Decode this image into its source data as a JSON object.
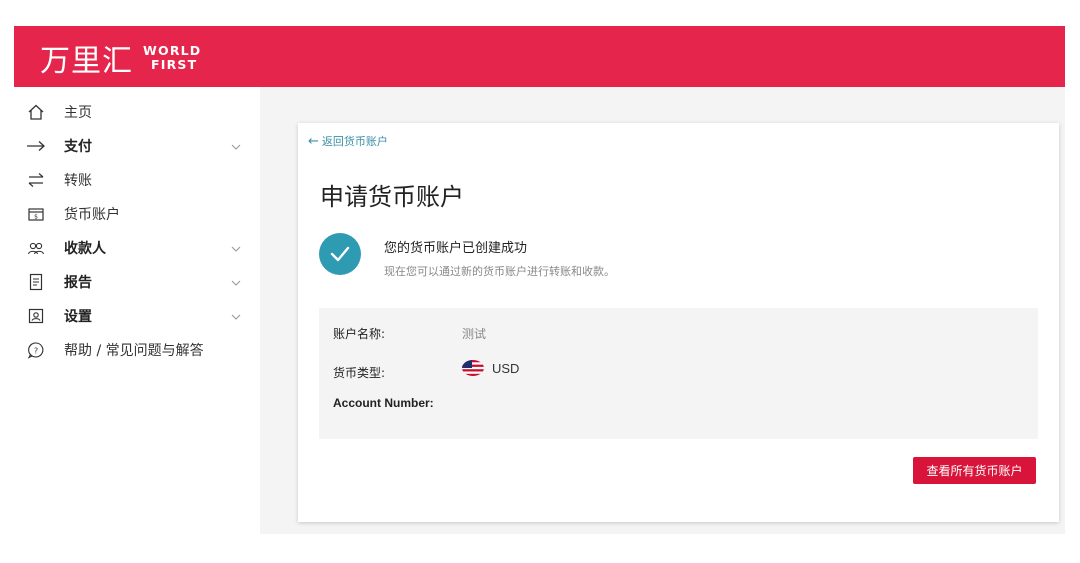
{
  "brand": {
    "logo_cn": "万里汇",
    "logo_en_line1": "WORLD",
    "logo_en_line2": "FIRST",
    "primary_color": "#e5254b",
    "accent_color": "#2f9bb2"
  },
  "sidebar": {
    "items": [
      {
        "label": "主页",
        "icon": "home-icon",
        "has_chevron": false
      },
      {
        "label": "支付",
        "icon": "arrow-right-icon",
        "has_chevron": true
      },
      {
        "label": "转账",
        "icon": "transfer-icon",
        "has_chevron": false
      },
      {
        "label": "货币账户",
        "icon": "wallet-icon",
        "has_chevron": false
      },
      {
        "label": "收款人",
        "icon": "users-icon",
        "has_chevron": true
      },
      {
        "label": "报告",
        "icon": "report-icon",
        "has_chevron": true
      },
      {
        "label": "设置",
        "icon": "settings-icon",
        "has_chevron": true
      },
      {
        "label": "帮助 / 常见问题与解答",
        "icon": "help-icon",
        "has_chevron": false
      }
    ]
  },
  "main": {
    "back_link": "返回货币账户",
    "title": "申请货币账户",
    "success_title": "您的货币账户已创建成功",
    "success_sub": "现在您可以通过新的货币账户进行转账和收款。",
    "details": {
      "account_name_label": "账户名称:",
      "account_name_value": "测试",
      "currency_label": "货币类型:",
      "currency_value": "USD",
      "currency_flag": "us-flag-icon",
      "account_number_label": "Account Number:",
      "account_number_value": ""
    },
    "view_all_button": "查看所有货币账户"
  }
}
